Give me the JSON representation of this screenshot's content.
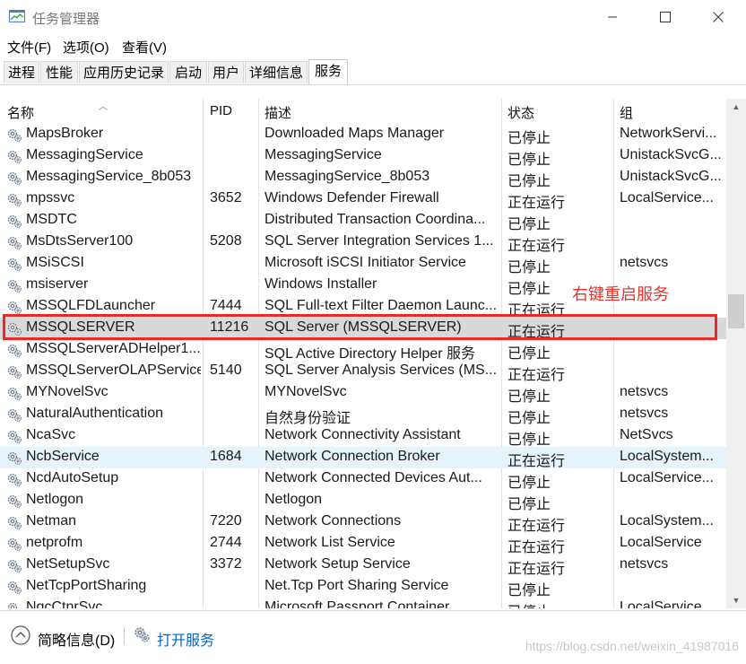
{
  "window": {
    "title": "任务管理器"
  },
  "menu": {
    "items": [
      "文件(F)",
      "选项(O)",
      "查看(V)"
    ]
  },
  "tabs": [
    "进程",
    "性能",
    "应用历史记录",
    "启动",
    "用户",
    "详细信息",
    "服务"
  ],
  "active_tab": "服务",
  "columns": {
    "name": "名称",
    "pid": "PID",
    "desc": "描述",
    "status": "状态",
    "group": "组"
  },
  "rows": [
    {
      "name": "MapsBroker",
      "pid": "",
      "desc": "Downloaded Maps Manager",
      "status": "已停止",
      "group": "NetworkServi..."
    },
    {
      "name": "MessagingService",
      "pid": "",
      "desc": "MessagingService",
      "status": "已停止",
      "group": "UnistackSvcG..."
    },
    {
      "name": "MessagingService_8b053",
      "pid": "",
      "desc": "MessagingService_8b053",
      "status": "已停止",
      "group": "UnistackSvcG..."
    },
    {
      "name": "mpssvc",
      "pid": "3652",
      "desc": "Windows Defender Firewall",
      "status": "正在运行",
      "group": "LocalService..."
    },
    {
      "name": "MSDTC",
      "pid": "",
      "desc": "Distributed Transaction Coordina...",
      "status": "已停止",
      "group": ""
    },
    {
      "name": "MsDtsServer100",
      "pid": "5208",
      "desc": "SQL Server Integration Services 1...",
      "status": "正在运行",
      "group": ""
    },
    {
      "name": "MSiSCSI",
      "pid": "",
      "desc": "Microsoft iSCSI Initiator Service",
      "status": "已停止",
      "group": "netsvcs"
    },
    {
      "name": "msiserver",
      "pid": "",
      "desc": "Windows Installer",
      "status": "已停止",
      "group": ""
    },
    {
      "name": "MSSQLFDLauncher",
      "pid": "7444",
      "desc": "SQL Full-text Filter Daemon Launc...",
      "status": "正在运行",
      "group": ""
    },
    {
      "name": "MSSQLSERVER",
      "pid": "11216",
      "desc": "SQL Server (MSSQLSERVER)",
      "status": "正在运行",
      "group": ""
    },
    {
      "name": "MSSQLServerADHelper1...",
      "pid": "",
      "desc": "SQL Active Directory Helper 服务",
      "status": "已停止",
      "group": ""
    },
    {
      "name": "MSSQLServerOLAPService",
      "pid": "5140",
      "desc": "SQL Server Analysis Services (MS...",
      "status": "正在运行",
      "group": ""
    },
    {
      "name": "MYNovelSvc",
      "pid": "",
      "desc": "MYNovelSvc",
      "status": "已停止",
      "group": "netsvcs"
    },
    {
      "name": "NaturalAuthentication",
      "pid": "",
      "desc": "自然身份验证",
      "status": "已停止",
      "group": "netsvcs"
    },
    {
      "name": "NcaSvc",
      "pid": "",
      "desc": "Network Connectivity Assistant",
      "status": "已停止",
      "group": "NetSvcs"
    },
    {
      "name": "NcbService",
      "pid": "1684",
      "desc": "Network Connection Broker",
      "status": "正在运行",
      "group": "LocalSystem..."
    },
    {
      "name": "NcdAutoSetup",
      "pid": "",
      "desc": "Network Connected Devices Aut...",
      "status": "已停止",
      "group": "LocalService..."
    },
    {
      "name": "Netlogon",
      "pid": "",
      "desc": "Netlogon",
      "status": "已停止",
      "group": ""
    },
    {
      "name": "Netman",
      "pid": "7220",
      "desc": "Network Connections",
      "status": "正在运行",
      "group": "LocalSystem..."
    },
    {
      "name": "netprofm",
      "pid": "2744",
      "desc": "Network List Service",
      "status": "正在运行",
      "group": "LocalService"
    },
    {
      "name": "NetSetupSvc",
      "pid": "3372",
      "desc": "Network Setup Service",
      "status": "正在运行",
      "group": "netsvcs"
    },
    {
      "name": "NetTcpPortSharing",
      "pid": "",
      "desc": "Net.Tcp Port Sharing Service",
      "status": "已停止",
      "group": ""
    },
    {
      "name": "NgcCtnrSvc",
      "pid": "",
      "desc": "Microsoft Passport Container",
      "status": "已停止",
      "group": "LocalService..."
    }
  ],
  "selected_row": "MSSQLSERVER",
  "hover_row": "NcbService",
  "annotation": "右键重启服务",
  "footer": {
    "brief": "简略信息(D)",
    "open_services": "打开服务"
  },
  "watermark": "https://blog.csdn.net/weixin_41987016",
  "colors": {
    "annotation": "#e8342c",
    "link": "#0066cc",
    "selected": "#d9d9d9",
    "hover": "#e5f3fb"
  }
}
